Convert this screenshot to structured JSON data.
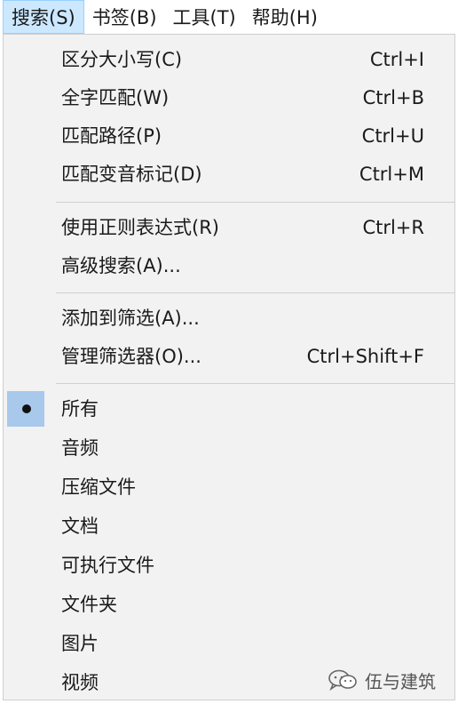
{
  "menubar": {
    "items": [
      {
        "label": "搜索(S)",
        "active": true
      },
      {
        "label": "书签(B)"
      },
      {
        "label": "工具(T)"
      },
      {
        "label": "帮助(H)"
      }
    ]
  },
  "menu": {
    "groups": [
      {
        "items": [
          {
            "label": "区分大小写(C)",
            "shortcut": "Ctrl+I"
          },
          {
            "label": "全字匹配(W)",
            "shortcut": "Ctrl+B"
          },
          {
            "label": "匹配路径(P)",
            "shortcut": "Ctrl+U"
          },
          {
            "label": "匹配变音标记(D)",
            "shortcut": "Ctrl+M"
          }
        ]
      },
      {
        "items": [
          {
            "label": "使用正则表达式(R)",
            "shortcut": "Ctrl+R"
          },
          {
            "label": "高级搜索(A)..."
          }
        ]
      },
      {
        "items": [
          {
            "label": "添加到筛选(A)..."
          },
          {
            "label": "管理筛选器(O)...",
            "shortcut": "Ctrl+Shift+F"
          }
        ]
      },
      {
        "items": [
          {
            "label": "所有",
            "selected": true
          },
          {
            "label": "音频"
          },
          {
            "label": "压缩文件"
          },
          {
            "label": "文档"
          },
          {
            "label": "可执行文件"
          },
          {
            "label": "文件夹"
          },
          {
            "label": "图片"
          },
          {
            "label": "视频"
          }
        ]
      }
    ]
  },
  "watermark": {
    "text": "伍与建筑",
    "icon": "wechat-icon"
  },
  "colors": {
    "menu_background": "#f2f2f2",
    "active_menubar_background": "#cce8ff",
    "selected_check_background": "#a8c8ec"
  }
}
